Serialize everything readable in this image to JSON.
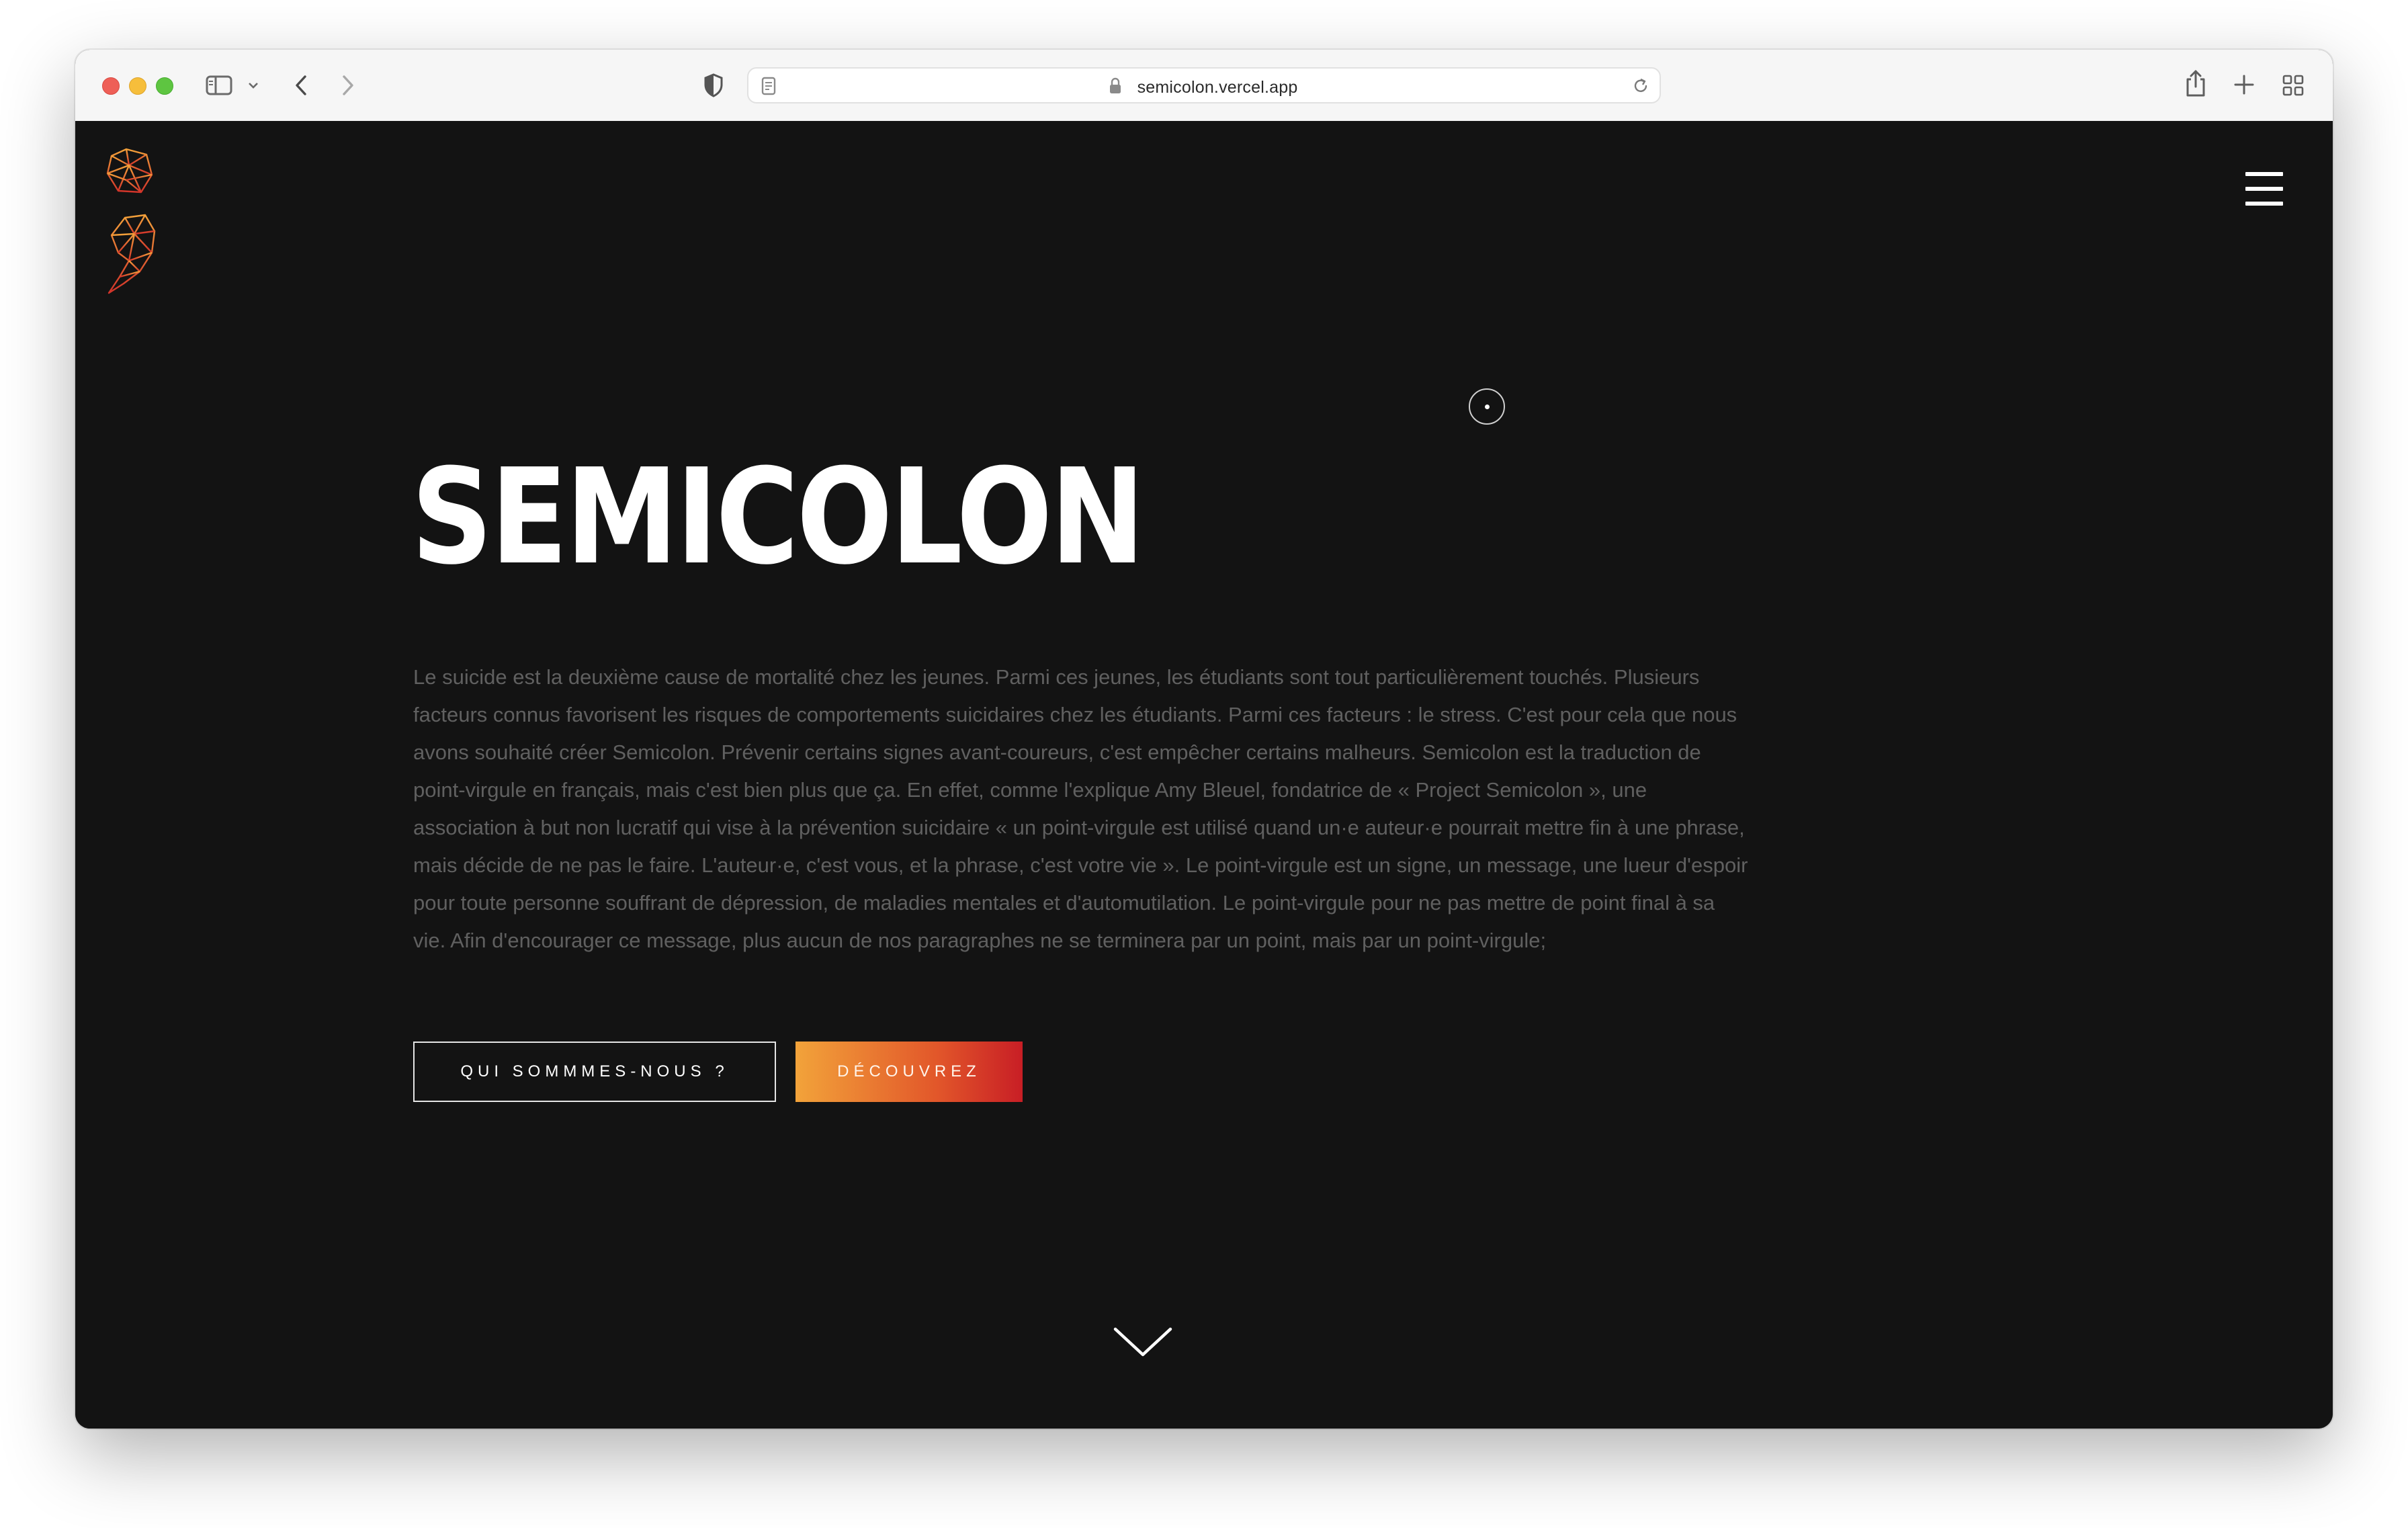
{
  "browser": {
    "url": "semicolon.vercel.app"
  },
  "page": {
    "title": "SEMICOLON",
    "intro": "Le suicide est la deuxième cause de mortalité chez les jeunes. Parmi ces jeunes, les étudiants sont tout particulièrement touchés. Plusieurs facteurs connus favorisent les risques de comportements suicidaires chez les étudiants. Parmi ces facteurs : le stress. C'est pour cela que nous avons souhaité créer Semicolon. Prévenir certains signes avant-coureurs, c'est empêcher certains malheurs. Semicolon est la traduction de point-virgule en français, mais c'est bien plus que ça. En effet, comme l'explique Amy Bleuel, fondatrice de « Project Semicolon », une association à but non lucratif qui vise à la prévention suicidaire « un point-virgule est utilisé quand un·e auteur·e pourrait mettre fin à une phrase, mais décide de ne pas le faire. L'auteur·e, c'est vous, et la phrase, c'est votre vie ». Le point-virgule est un signe, un message, une lueur d'espoir pour toute personne souffrant de dépression, de maladies mentales et d'automutilation. Le point-virgule pour ne pas mettre de point final à sa vie. Afin d'encourager ce message, plus aucun de nos paragraphes ne se terminera par un point, mais par un point-virgule;",
    "buttons": {
      "about": "QUI SOMMMES-NOUS ?",
      "discover": "DÉCOUVREZ"
    }
  },
  "icons": {
    "logo": "semicolon-low-poly-logo",
    "menu": "hamburger-menu-icon",
    "scroll": "chevron-down-icon"
  },
  "colors": {
    "background": "#131313",
    "accent_start": "#f2a33a",
    "accent_end": "#c81e25",
    "text_muted": "#606060"
  }
}
